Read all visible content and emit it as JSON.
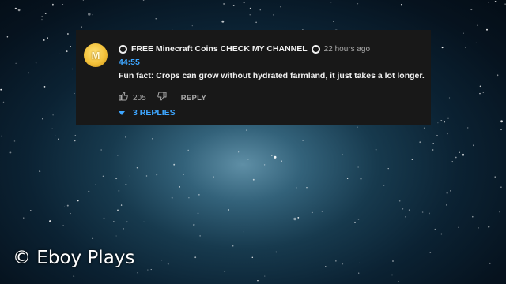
{
  "comment": {
    "author": "FREE Minecraft Coins CHECK MY CHANNEL",
    "time_ago": "22 hours ago",
    "timestamp_link": "44:55",
    "text": "Fun fact: Crops can grow without hydrated farmland, it just takes a lot longer.",
    "like_count": "205",
    "reply_label": "REPLY",
    "replies_label": "3 REPLIES",
    "avatar_letter": "M"
  },
  "watermark": {
    "text": "© Eboy Plays"
  },
  "colors": {
    "card_bg": "#181818",
    "link_blue": "#3ea6ff",
    "text_primary": "#f1f1f1",
    "text_secondary": "#aaaaaa"
  },
  "icons": [
    "verified-ring-icon",
    "thumbs-up-icon",
    "thumbs-down-icon",
    "caret-down-icon"
  ]
}
